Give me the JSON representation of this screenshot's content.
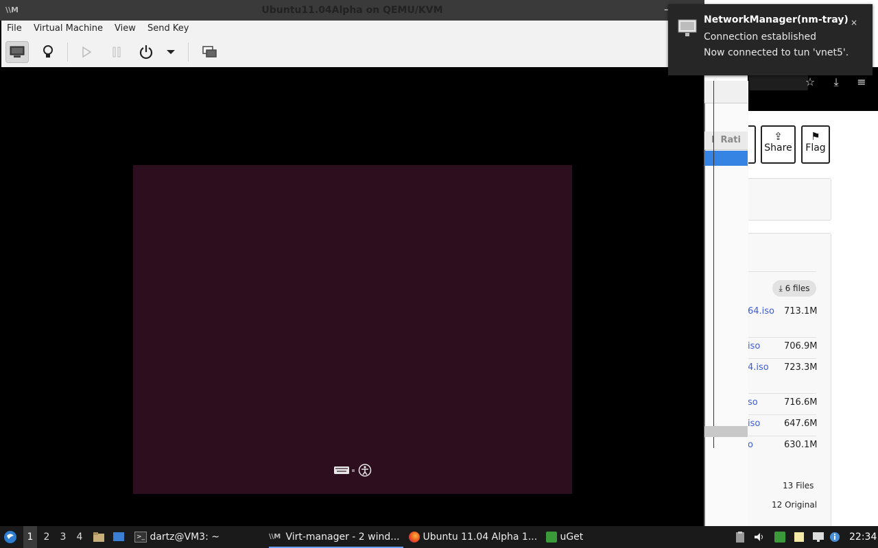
{
  "vm_window": {
    "title": "Ubuntu11.04Alpha on QEMU/KVM",
    "app_icon_text": "\\\\M",
    "minimize_glyph": "–",
    "menu": [
      "File",
      "Virtual Machine",
      "View",
      "Send Key"
    ]
  },
  "toolbar": {
    "buttons": [
      "console-monitor-icon",
      "details-lightbulb-icon",
      "run-play-icon",
      "pause-icon",
      "power-icon",
      "power-dropdown-icon",
      "fullscreen-icon"
    ]
  },
  "guest": {
    "background_color": "#2c0e1e",
    "status_icons": [
      "keyboard-icon",
      "accessibility-icon"
    ]
  },
  "notification": {
    "title": "NetworkManager(nm-tray)",
    "line1": "Connection established",
    "line2": "Now connected to tun 'vnet5'.",
    "close": "×"
  },
  "middle_dialog": {
    "column_header": "l  Rati"
  },
  "browser": {
    "buttons": [
      {
        "label": "Share",
        "icon": "share-icon"
      },
      {
        "label": "Flag",
        "icon": "flag-icon"
      }
    ],
    "download_badge": "6 files",
    "files": [
      {
        "name": "64.iso",
        "size": "713.1M"
      },
      {
        "name": "iso",
        "size": "706.9M"
      },
      {
        "name": "4.iso",
        "size": "723.3M"
      },
      {
        "name": "so",
        "size": "716.6M"
      },
      {
        "name": "iso",
        "size": "647.6M"
      },
      {
        "name": "o",
        "size": "630.1M"
      }
    ],
    "summary": [
      "13 Files",
      "12 Original"
    ]
  },
  "taskbar": {
    "workspaces": [
      "1",
      "2",
      "3",
      "4"
    ],
    "active_workspace": "1",
    "tasks": [
      {
        "label": "dartz@VM3: ~",
        "icon": "terminal-icon"
      },
      {
        "label": "Virt-manager - 2 wind...",
        "icon": "virt-manager-icon"
      },
      {
        "label": "Ubuntu 11.04 Alpha 1...",
        "icon": "firefox-icon"
      },
      {
        "label": "uGet",
        "icon": "uget-icon"
      }
    ],
    "clock": "22:34"
  }
}
